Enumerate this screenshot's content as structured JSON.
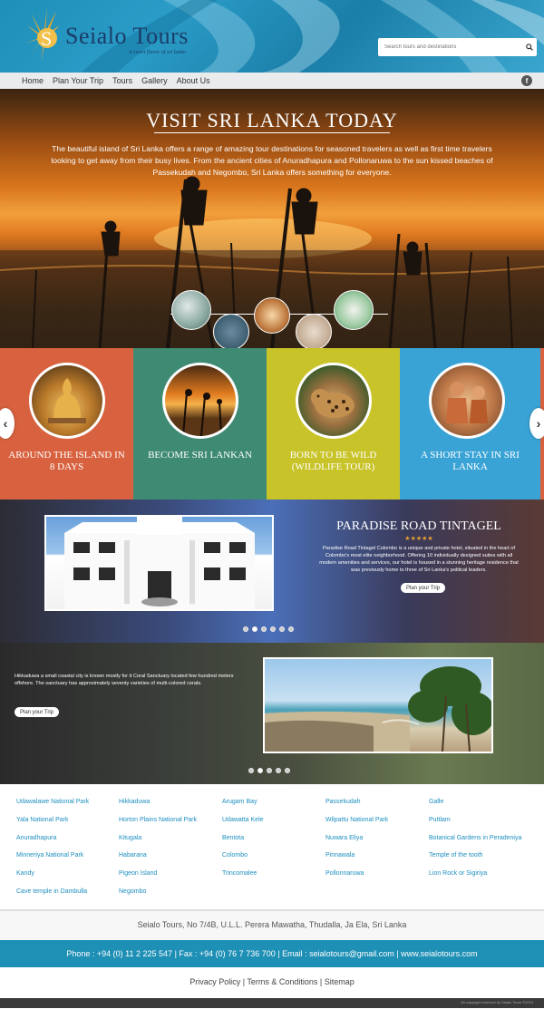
{
  "header": {
    "brand": "Seialo Tours",
    "tagline": "A sweet flavor of sri lanka",
    "search_placeholder": "Search tours and destinations"
  },
  "nav": {
    "items": [
      "Home",
      "Plan Your Trip",
      "Tours",
      "Gallery",
      "About Us"
    ],
    "facebook": "f"
  },
  "hero": {
    "title": "Visit Sri Lanka Today",
    "text": "The beautiful island of Sri Lanka offers a range of amazing tour destinations for seasoned travelers as well as first time travelers looking to get away from their busy lives. From the ancient cities of Anuradhapura and Pollonaruwa to the sun kissed beaches of Passekudah and Negombo, Sri Lanka offers something for everyone."
  },
  "tours": [
    {
      "label": "Around the Island in 8 Days",
      "color": "#d8623f"
    },
    {
      "label": "Become Sri Lankan",
      "color": "#3f8a73"
    },
    {
      "label": "Born to be wild (Wildlife Tour)",
      "color": "#c9c32a"
    },
    {
      "label": "A Short Stay in Sri Lanka",
      "color": "#3aa3d6"
    }
  ],
  "slider_arrows": {
    "prev": "‹",
    "next": "›"
  },
  "hotel": {
    "title": "Paradise Road Tintagel",
    "stars": "★★★★★",
    "text": "Paradise Road Tintagel Colombo is a unique and private hotel, situated in the heart of Colombo's most elite neighborhood. Offering 10 individually designed suites with all modern amenities and services, our hotel is housed in a stunning heritage residence that was previously home to three of Sri Lanka's political leaders.",
    "button": "Plan your Trip",
    "slide_count": 6,
    "active_slide": 2
  },
  "beach": {
    "text": "Hikkaduwa a small coastal city is known mostly for it Coral Sanctuary located few hundred meters offshore. The sanctuary has approximately seventy varieties of multi-colored corals.",
    "button": "Plan your Trip",
    "slide_count": 5,
    "active_slide": 2
  },
  "destinations": [
    [
      "Udawalawe National Park",
      "Yala National Park",
      "Anuradhapura",
      "Minneriya National Park",
      "Kandy",
      "Cave temple in Dambulla"
    ],
    [
      "Hikkaduwa",
      "Horton Plains National Park",
      "Kitugala",
      "Habarana",
      "Pigeon Island",
      "Negombo"
    ],
    [
      "Arugam Bay",
      "Udawatta Kele",
      "Bentota",
      "Colombo",
      "Trincomalee"
    ],
    [
      "Passekudah",
      "Wilpattu National Park",
      "Nuwara Eliya",
      "Pinnawala",
      "Pollonnaruwa"
    ],
    [
      "Galle",
      "Puttlam",
      "Botanical Gardens in Peradeniya",
      "Temple of the tooth",
      "Lion Rock or Sigiriya"
    ]
  ],
  "footer": {
    "address": "Seialo Tours, No 7/4B, U.L.L. Perera Mawatha, Thudalla, Ja Ela, Sri Lanka",
    "contact": "Phone : +94 (0) 11 2 225 547 | Fax : +94 (0) 76 7 736 700 | Email : seialotours@gmail.com | www.seialotours.com",
    "links": "Privacy Policy | Terms & Conditions | Sitemap",
    "credit": "All copyright reserved by Seialo Tours ©2013"
  }
}
